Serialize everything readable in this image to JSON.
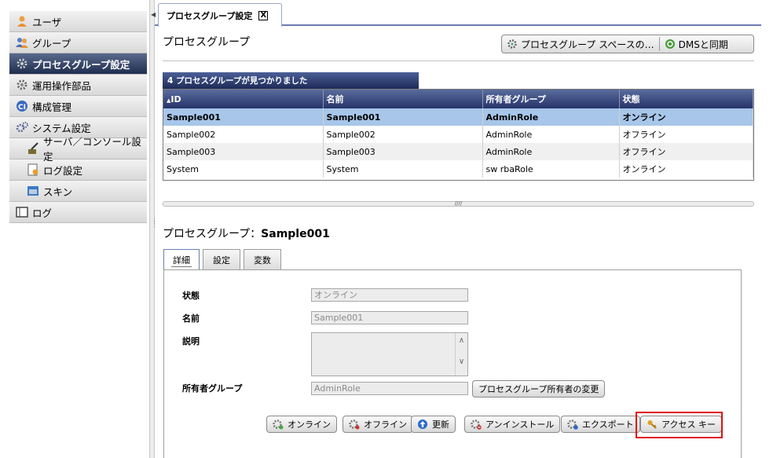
{
  "sidebar": {
    "items": [
      {
        "label": "ユーザ",
        "icon": "user-icon",
        "sub": false,
        "active": false
      },
      {
        "label": "グループ",
        "icon": "group-icon",
        "sub": false,
        "active": false
      },
      {
        "label": "プロセスグループ設定",
        "icon": "process-group-icon",
        "sub": false,
        "active": true
      },
      {
        "label": "運用操作部品",
        "icon": "gear-icon",
        "sub": false,
        "active": false
      },
      {
        "label": "構成管理",
        "icon": "ci-icon",
        "sub": false,
        "active": false
      },
      {
        "label": "システム設定",
        "icon": "settings-icon",
        "sub": false,
        "active": false
      },
      {
        "label": "サーバ／コンソール設定",
        "icon": "server-icon",
        "sub": true,
        "active": false
      },
      {
        "label": "ログ設定",
        "icon": "log-settings-icon",
        "sub": true,
        "active": false
      },
      {
        "label": "スキン",
        "icon": "skin-icon",
        "sub": true,
        "active": false
      },
      {
        "label": "ログ",
        "icon": "log-icon",
        "sub": false,
        "active": false
      }
    ]
  },
  "tab": {
    "title": "プロセスグループ設定",
    "close": "X"
  },
  "header": {
    "title": "プロセスグループ",
    "space_button": "プロセスグループ スペースの…",
    "dms_button": "DMSと同期"
  },
  "grid": {
    "found_text": "4 プロセスグループが見つかりました",
    "columns": [
      "ID",
      "名前",
      "所有者グループ",
      "状態"
    ],
    "sort_indicator": "▲",
    "rows": [
      [
        "Sample001",
        "Sample001",
        "AdminRole",
        "オンライン"
      ],
      [
        "Sample002",
        "Sample002",
        "AdminRole",
        "オフライン"
      ],
      [
        "Sample003",
        "Sample003",
        "AdminRole",
        "オフライン"
      ],
      [
        "System",
        "System",
        "sw rbaRole",
        "オンライン"
      ]
    ],
    "drag_handle": "////"
  },
  "detail": {
    "title_prefix": "プロセスグループ：",
    "title_name": "Sample001",
    "tabs": [
      "詳細",
      "設定",
      "変数"
    ],
    "fields": {
      "status_label": "状態",
      "status_value": "オンライン",
      "name_label": "名前",
      "name_value": "Sample001",
      "desc_label": "説明",
      "owner_label": "所有者グループ",
      "owner_value": "AdminRole",
      "change_owner_button": "プロセスグループ所有者の変更"
    },
    "buttons": {
      "online": "オンライン",
      "offline": "オフライン",
      "update": "更新",
      "uninstall": "アンインストール",
      "export": "エクスポート",
      "access_key": "アクセス キー"
    }
  },
  "colors": {
    "header_dark": "#1f2d4f",
    "selected_row": "#a7c6e9",
    "highlight": "#e01010"
  }
}
